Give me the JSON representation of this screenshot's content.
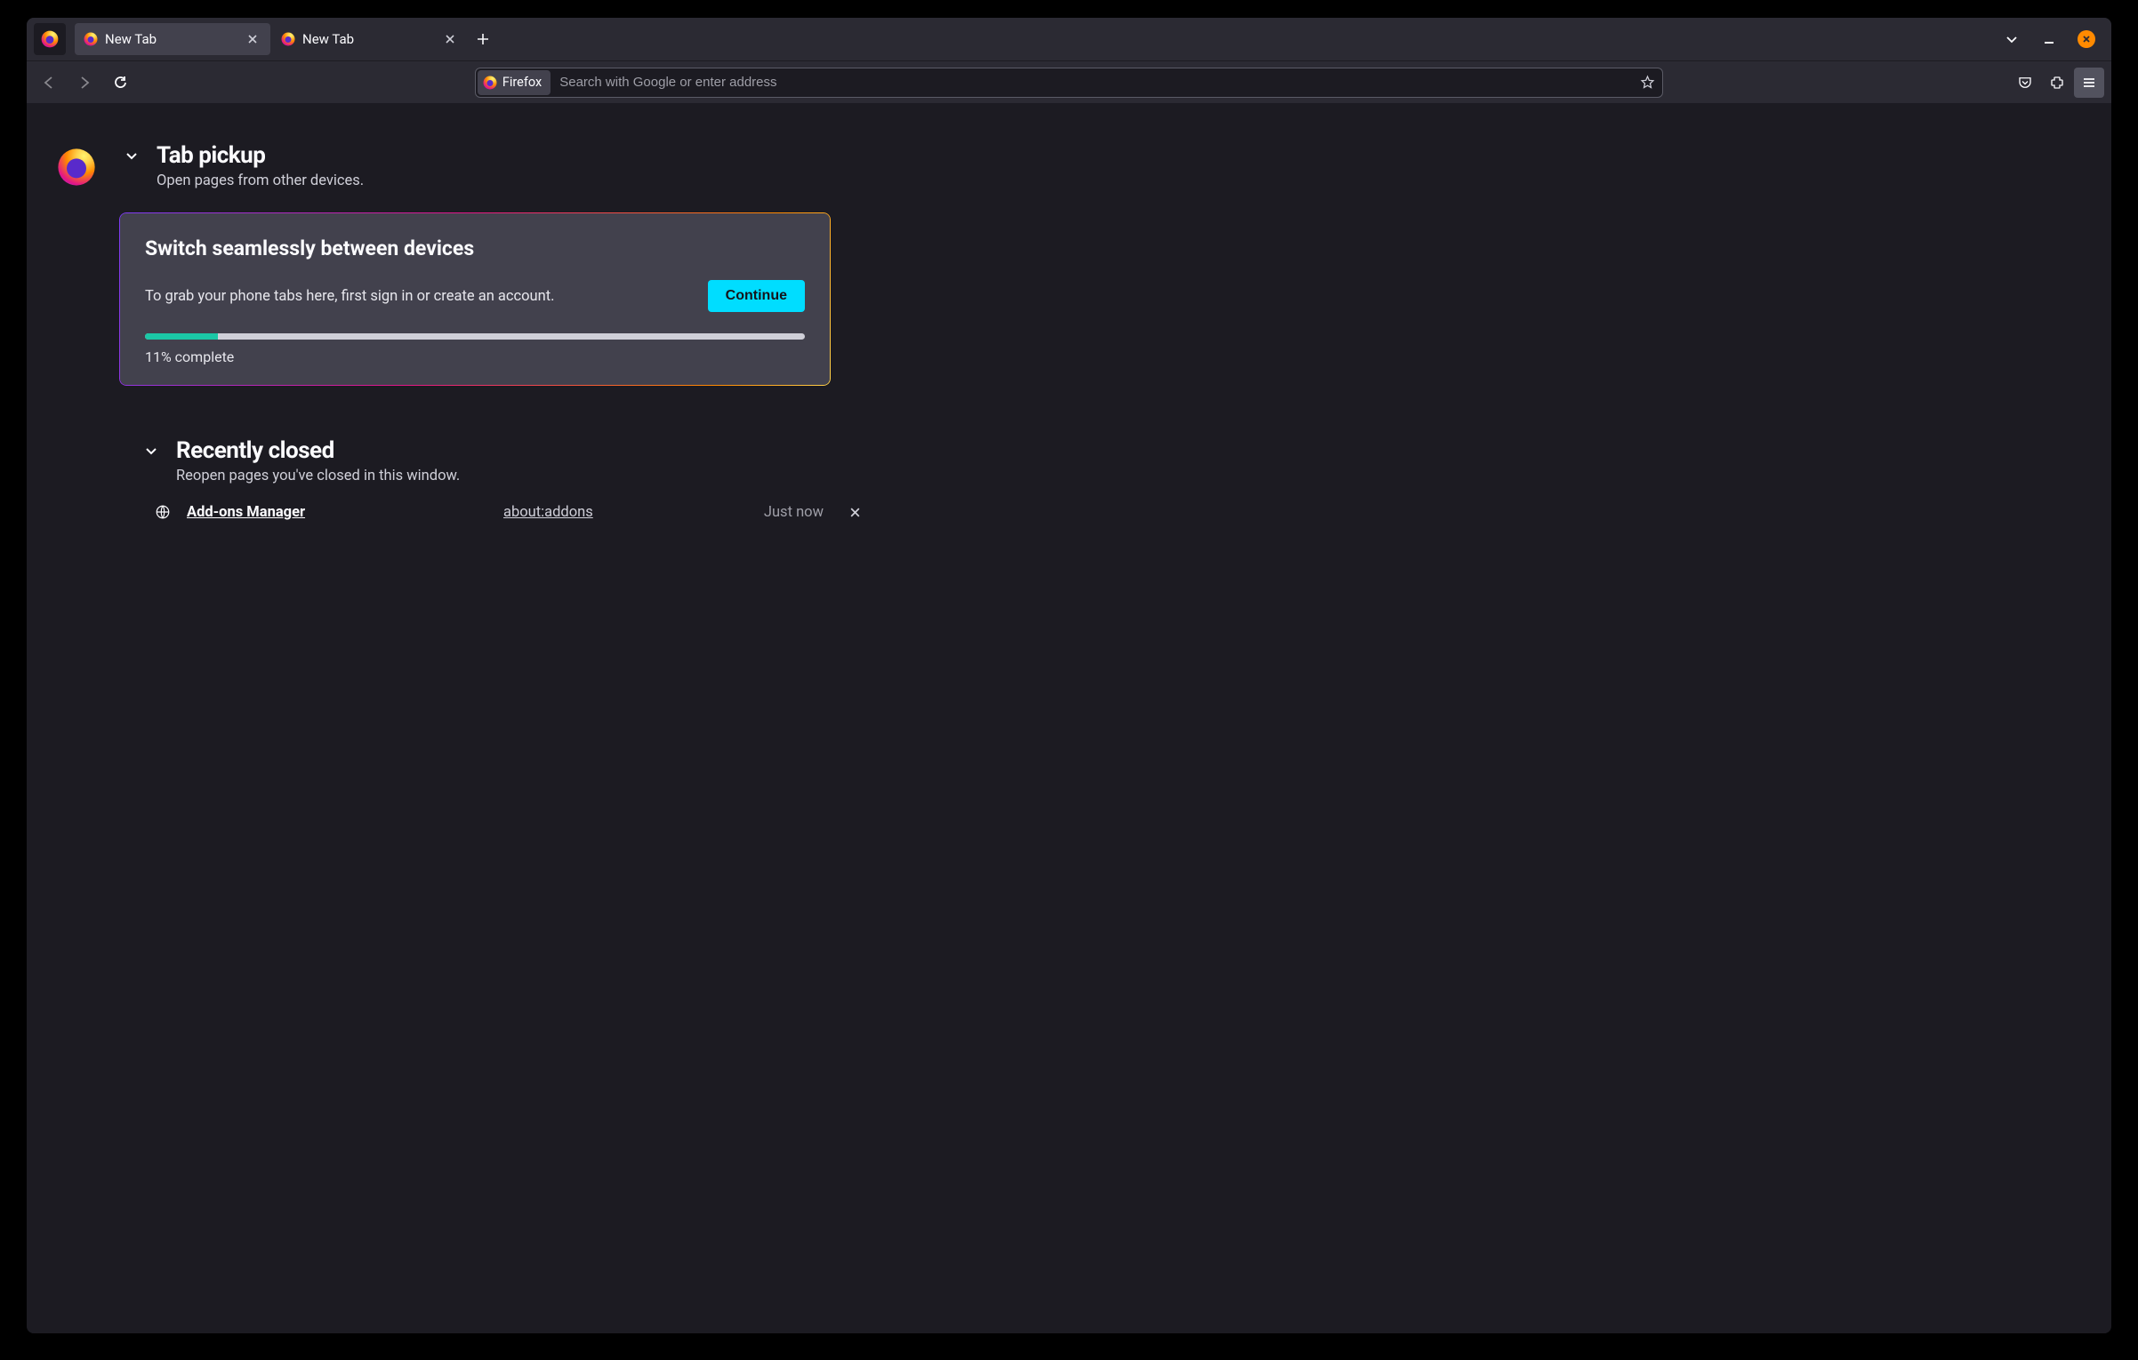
{
  "tabs": [
    {
      "title": "New Tab",
      "active": true
    },
    {
      "title": "New Tab",
      "active": false
    }
  ],
  "urlbar": {
    "chip_label": "Firefox",
    "placeholder": "Search with Google or enter address"
  },
  "tab_pickup": {
    "title": "Tab pickup",
    "subtitle": "Open pages from other devices.",
    "card_title": "Switch seamlessly between devices",
    "card_text": "To grab your phone tabs here, first sign in or create an account.",
    "continue_label": "Continue",
    "progress_percent": 11,
    "progress_label": "11% complete"
  },
  "recently_closed": {
    "title": "Recently closed",
    "subtitle": "Reopen pages you've closed in this window.",
    "items": [
      {
        "title": "Add-ons Manager",
        "url": "about:addons",
        "time": "Just now"
      }
    ]
  }
}
